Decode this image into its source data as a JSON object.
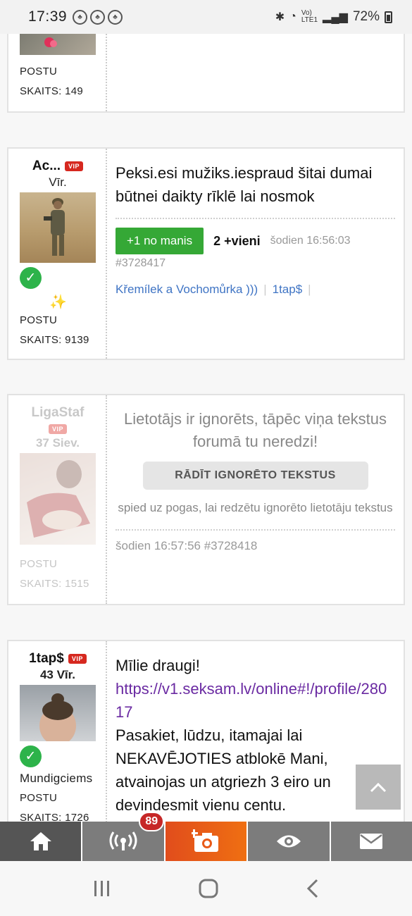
{
  "status_bar": {
    "time": "17:39",
    "battery": "72%"
  },
  "posts": [
    {
      "stat_label": "POSTU",
      "stat_count": "SKAITS: 149"
    },
    {
      "username": "Ac...",
      "vip": "VIP",
      "subtitle": "Vīr.",
      "stat_label": "POSTU",
      "stat_count": "SKAITS: 9139",
      "text": "Peksi.esi mužiks.iespraud šitai dumai būtnei daikty rīklē lai nosmok",
      "plus_label": "+1 no manis",
      "votes": "2 +vieni",
      "timestamp": "šodien 16:56:03",
      "post_id": "#3728417",
      "link_1": "Křemílek a Vochomůrka )))",
      "link_2": "1tap$"
    },
    {
      "username": "LigaStaf",
      "vip": "VIP",
      "subtitle": "37 Siev.",
      "stat_label": "POSTU",
      "stat_count": "SKAITS: 1515",
      "ignored_title": "Lietotājs ir ignorēts, tāpēc viņa tekstus forumā tu neredzi!",
      "show_button": "RĀDĪT IGNORĒTO TEKSTUS",
      "ignored_note": "spied uz pogas, lai redzētu ignorēto lietotāju tekstus",
      "timestamp_id": "šodien 16:57:56 #3728418"
    },
    {
      "username": "1tap$",
      "vip": "VIP",
      "subtitle": "43 Vīr.",
      "location": "Mundigciems",
      "stat_label": "POSTU",
      "stat_count": "SKAITS: 1726",
      "line_1": "Mīlie draugi!",
      "link": "https://v1.seksam.lv/online#!/profile/28017",
      "line_2": "Pasakiet, lūdzu, itamajai lai NEKAVĒJOTIES atblokē Mani, atvainojas un atgriezh 3 eiro un devindesmit vienu centu."
    }
  ],
  "bottom_nav": {
    "badge": "89",
    "items": [
      "home-icon",
      "broadcast-icon",
      "add-photo-icon",
      "eye-icon",
      "mail-icon"
    ]
  },
  "colors": {
    "green": "#35a836",
    "vip_red": "#d6281f",
    "link_blue": "#3f74c4",
    "camera_orange": "#e14d1c"
  }
}
